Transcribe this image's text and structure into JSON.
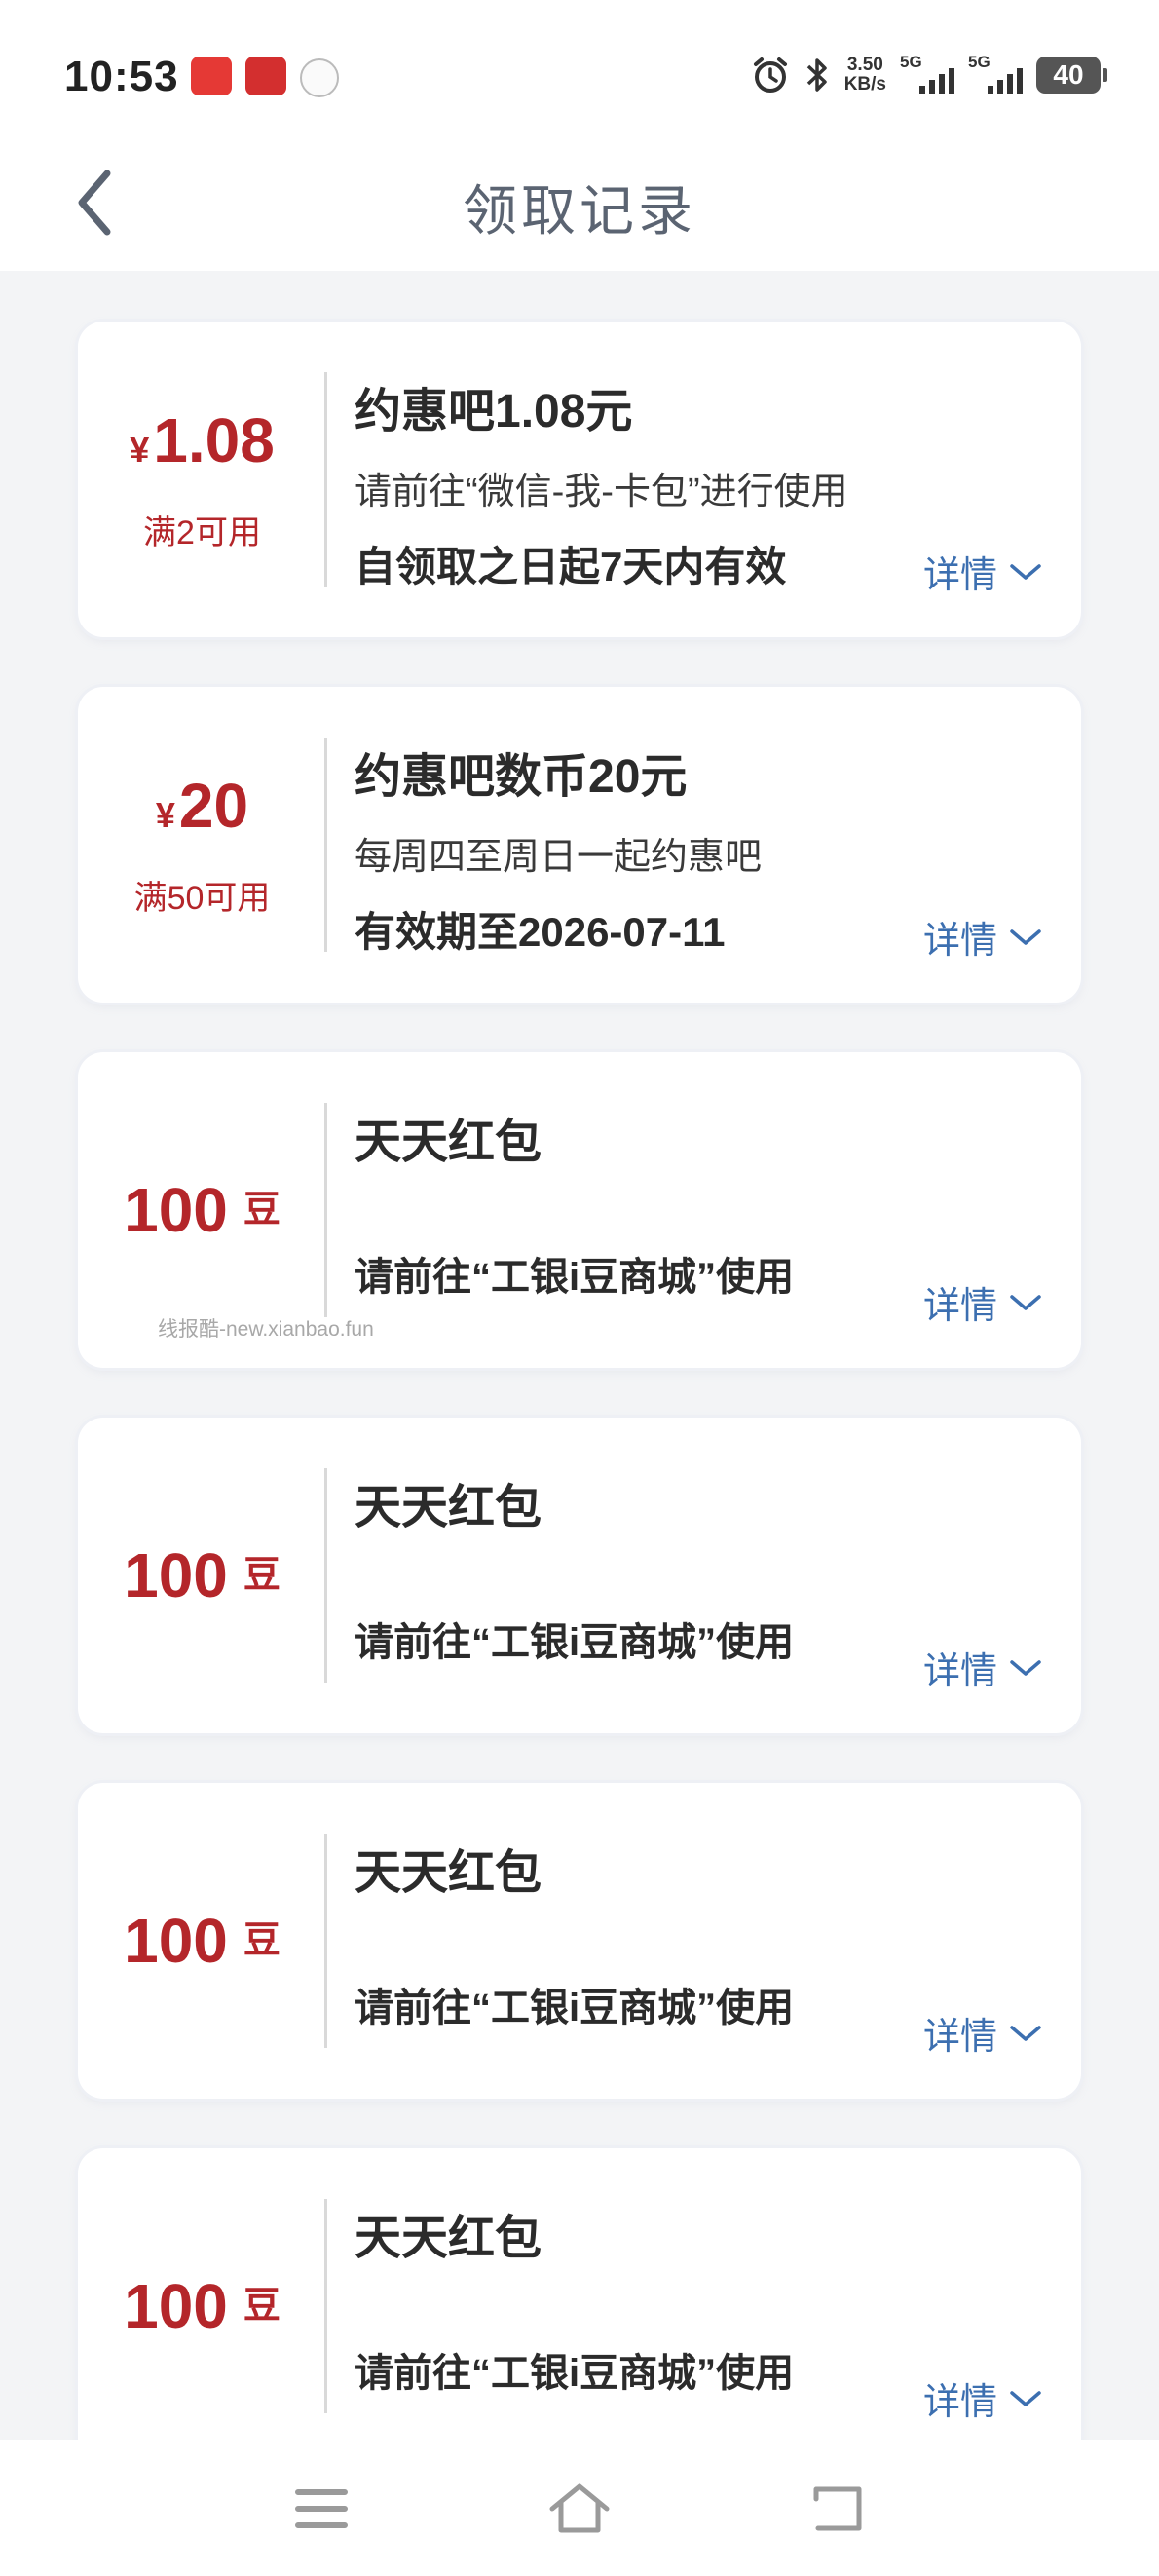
{
  "status_bar": {
    "time": "10:53",
    "net_speed_value": "3.50",
    "net_speed_unit": "KB/s",
    "signal_1_label": "5G",
    "signal_2_label": "5G",
    "battery_level": "40"
  },
  "header": {
    "title": "领取记录",
    "back_icon": "chevron-left-icon"
  },
  "colors": {
    "amount_red": "#b4262a",
    "details_blue": "#3c6fb0",
    "title_gray": "#5b6472"
  },
  "records": [
    {
      "currency": "¥",
      "amount": "1.08",
      "condition": "满2可用",
      "name": "约惠吧1.08元",
      "description": "请前往“微信-我-卡包”进行使用",
      "validity": "自领取之日起7天内有效",
      "details_label": "详情"
    },
    {
      "currency": "¥",
      "amount": "20",
      "condition": "满50可用",
      "name": "约惠吧数币20元",
      "description": "每周四至周日一起约惠吧",
      "validity": "有效期至2026-07-11",
      "details_label": "详情"
    },
    {
      "amount": "100",
      "unit": "豆",
      "name": "天天红包",
      "usage": "请前往“工银i豆商城”使用",
      "details_label": "详情"
    },
    {
      "amount": "100",
      "unit": "豆",
      "name": "天天红包",
      "usage": "请前往“工银i豆商城”使用",
      "details_label": "详情"
    },
    {
      "amount": "100",
      "unit": "豆",
      "name": "天天红包",
      "usage": "请前往“工银i豆商城”使用",
      "details_label": "详情"
    },
    {
      "amount": "100",
      "unit": "豆",
      "name": "天天红包",
      "usage": "请前往“工银i豆商城”使用",
      "details_label": "详情"
    }
  ],
  "watermark": "线报酷-new.xianbao.fun",
  "nav_icons": [
    "menu-icon",
    "home-icon",
    "back-icon"
  ]
}
